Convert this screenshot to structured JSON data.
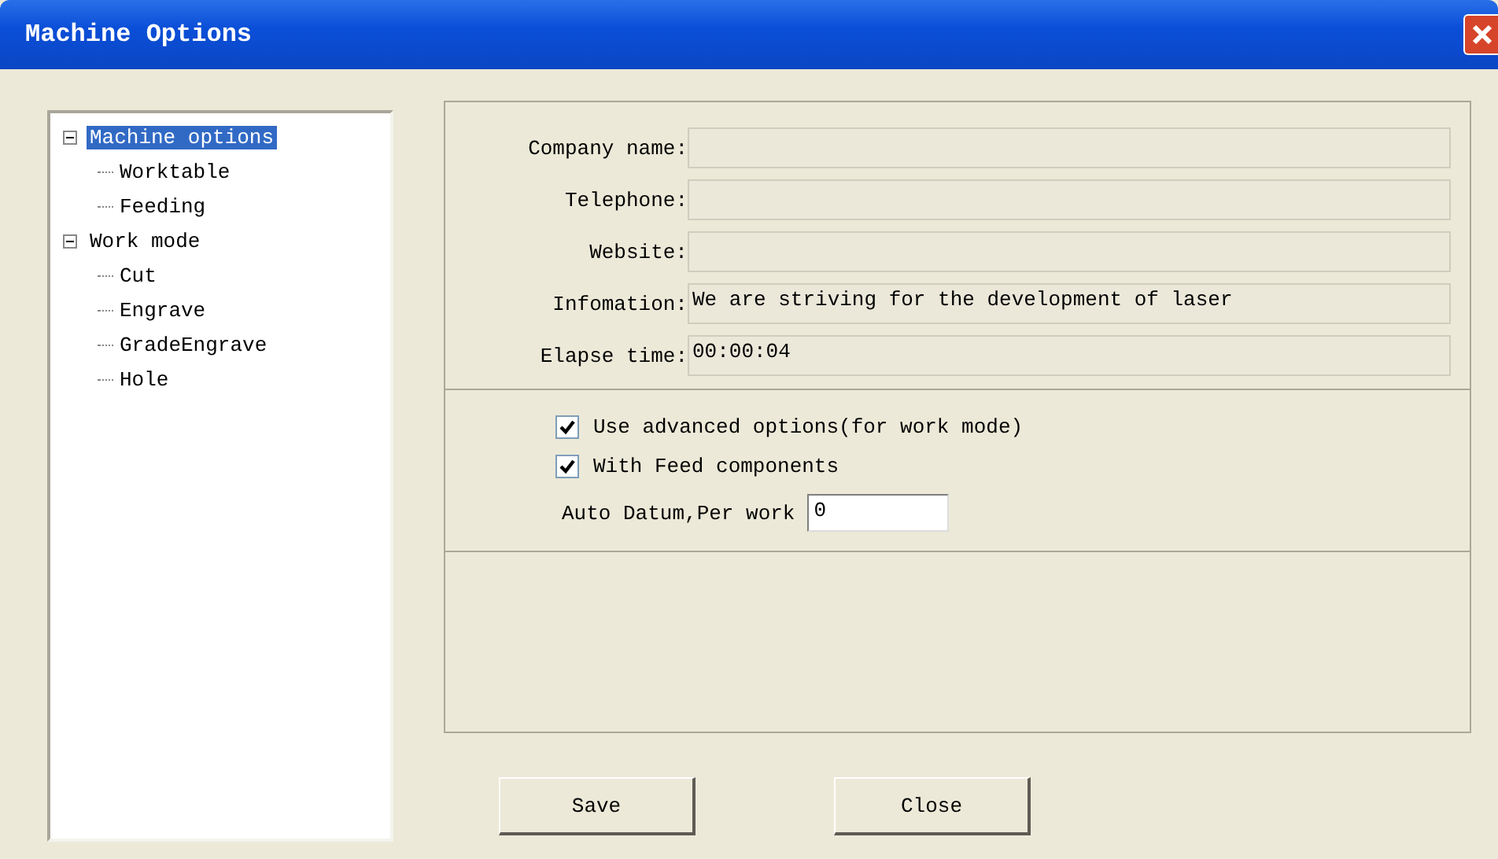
{
  "window": {
    "title": "Machine Options"
  },
  "tree": [
    {
      "label": "Machine options",
      "selected": true,
      "expanded": true,
      "children": [
        {
          "label": "Worktable",
          "selected": false
        },
        {
          "label": "Feeding",
          "selected": false
        }
      ]
    },
    {
      "label": "Work mode",
      "selected": false,
      "expanded": true,
      "children": [
        {
          "label": "Cut",
          "selected": false
        },
        {
          "label": "Engrave",
          "selected": false
        },
        {
          "label": "GradeEngrave",
          "selected": false
        },
        {
          "label": "Hole",
          "selected": false
        }
      ]
    }
  ],
  "info_fields": [
    {
      "label": "Company name:"
    },
    {
      "label": "Telephone:"
    },
    {
      "label": "Website:"
    },
    {
      "label": "Infomation:",
      "value": "We are striving for the development of laser"
    },
    {
      "label": "Elapse time:",
      "value": "00:00:04"
    }
  ],
  "options": [
    {
      "label": "Use advanced options(for work mode)",
      "checked": true
    },
    {
      "label": "With Feed components",
      "checked": true
    }
  ],
  "auto_datum": {
    "label": "Auto Datum,Per work",
    "value": "0"
  },
  "buttons": [
    "Save",
    "Close"
  ]
}
